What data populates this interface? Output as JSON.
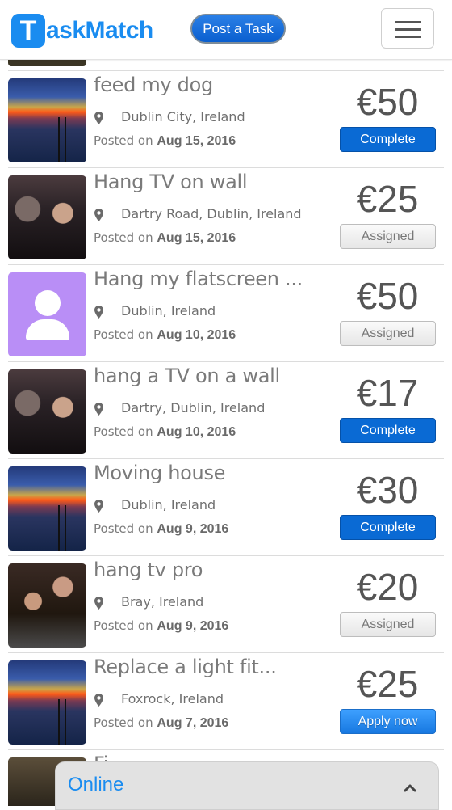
{
  "header": {
    "logo_mark": "T",
    "logo_text": "askMatch",
    "post_task_label": "Post a Task"
  },
  "tasks": [
    {
      "title": "feed my dog",
      "location": "Dublin City, Ireland",
      "posted_prefix": "Posted on",
      "date": "Aug 15, 2016",
      "price": "€50",
      "status": "Complete",
      "thumb": "sunset"
    },
    {
      "title": "Hang TV on wall",
      "location": "Dartry Road, Dublin, Ireland",
      "posted_prefix": "Posted on",
      "date": "Aug 15, 2016",
      "price": "€25",
      "status": "Assigned",
      "thumb": "crowd"
    },
    {
      "title": "Hang my flatscreen ...",
      "location": "Dublin, Ireland",
      "posted_prefix": "Posted on",
      "date": "Aug 10, 2016",
      "price": "€50",
      "status": "Assigned",
      "thumb": "avatar"
    },
    {
      "title": "hang a TV on a wall",
      "location": "Dartry, Dublin, Ireland",
      "posted_prefix": "Posted on",
      "date": "Aug 10, 2016",
      "price": "€17",
      "status": "Complete",
      "thumb": "crowd"
    },
    {
      "title": "Moving house",
      "location": "Dublin, Ireland",
      "posted_prefix": "Posted on",
      "date": "Aug 9, 2016",
      "price": "€30",
      "status": "Complete",
      "thumb": "sunset"
    },
    {
      "title": "hang tv pro",
      "location": "Bray, Ireland",
      "posted_prefix": "Posted on",
      "date": "Aug 9, 2016",
      "price": "€20",
      "status": "Assigned",
      "thumb": "couple"
    },
    {
      "title": "Replace a light fit...",
      "location": "Foxrock, Ireland",
      "posted_prefix": "Posted on",
      "date": "Aug 7, 2016",
      "price": "€25",
      "status": "Apply now",
      "thumb": "sunset"
    }
  ],
  "partial_task": {
    "title": "Fi"
  },
  "chat_bar": {
    "label": "Online",
    "icon": "chevron-up-icon"
  },
  "colors": {
    "brand": "#1a8cf0",
    "complete": "#0a6ad4",
    "apply": "#1e88f0"
  }
}
